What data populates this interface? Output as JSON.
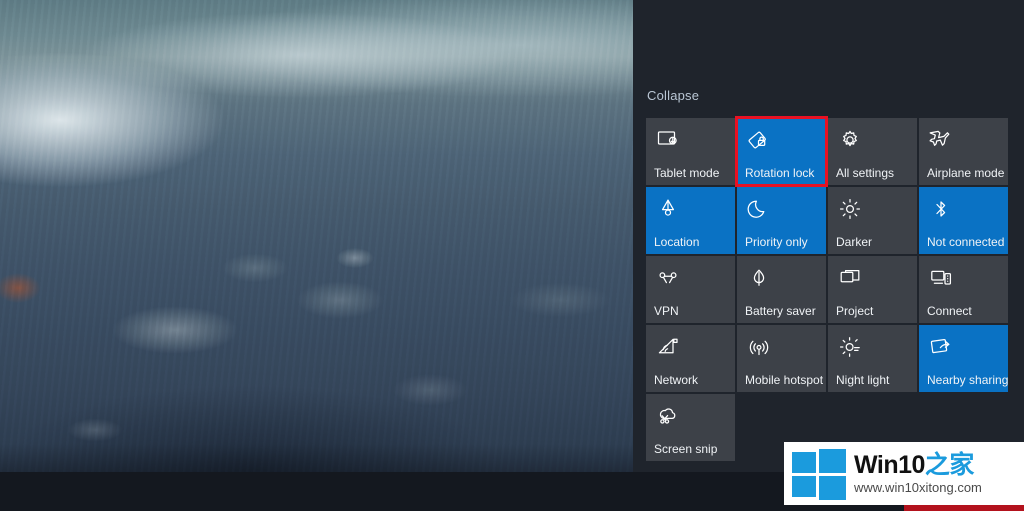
{
  "desktop": {
    "wallpaper_alt": "misty water over stones wallpaper"
  },
  "action_center": {
    "collapse_label": "Collapse",
    "accent_color": "#0a72c4",
    "tile_color": "#3d4148",
    "panel_color": "#1f242c",
    "highlight_color": "#e81123",
    "tiles": [
      {
        "label": "Tablet mode",
        "icon": "tablet-mode-icon",
        "state": "off",
        "highlighted": false
      },
      {
        "label": "Rotation lock",
        "icon": "rotation-lock-icon",
        "state": "on",
        "highlighted": true
      },
      {
        "label": "All settings",
        "icon": "gear-icon",
        "state": "off",
        "highlighted": false
      },
      {
        "label": "Airplane mode",
        "icon": "airplane-icon",
        "state": "off",
        "highlighted": false
      },
      {
        "label": "Location",
        "icon": "location-icon",
        "state": "on",
        "highlighted": false
      },
      {
        "label": "Priority only",
        "icon": "moon-icon",
        "state": "on",
        "highlighted": false
      },
      {
        "label": "Darker",
        "icon": "brightness-icon",
        "state": "off",
        "highlighted": false
      },
      {
        "label": "Not connected",
        "icon": "bluetooth-icon",
        "state": "on",
        "highlighted": false
      },
      {
        "label": "VPN",
        "icon": "vpn-icon",
        "state": "off",
        "highlighted": false
      },
      {
        "label": "Battery saver",
        "icon": "battery-saver-icon",
        "state": "off",
        "highlighted": false
      },
      {
        "label": "Project",
        "icon": "project-icon",
        "state": "off",
        "highlighted": false
      },
      {
        "label": "Connect",
        "icon": "connect-icon",
        "state": "off",
        "highlighted": false
      },
      {
        "label": "Network",
        "icon": "network-icon",
        "state": "off",
        "highlighted": false
      },
      {
        "label": "Mobile hotspot",
        "icon": "hotspot-icon",
        "state": "off",
        "highlighted": false
      },
      {
        "label": "Night light",
        "icon": "night-light-icon",
        "state": "off",
        "highlighted": false
      },
      {
        "label": "Nearby sharing",
        "icon": "nearby-sharing-icon",
        "state": "on",
        "highlighted": false
      },
      {
        "label": "Screen snip",
        "icon": "screen-snip-icon",
        "state": "off",
        "highlighted": false
      }
    ]
  },
  "taskbar": {
    "tray_items": [
      {
        "name": "show-hidden-icons-chevron-icon"
      },
      {
        "name": "app-notification-icon"
      },
      {
        "name": "volume-icon"
      },
      {
        "name": "onedrive-icon"
      },
      {
        "name": "battery-icon"
      },
      {
        "name": "network-tray-icon"
      }
    ]
  },
  "watermark": {
    "title_main": "Win10",
    "title_accent": "之家",
    "url": "www.win10xitong.com",
    "brand_color": "#1b9bdd"
  }
}
